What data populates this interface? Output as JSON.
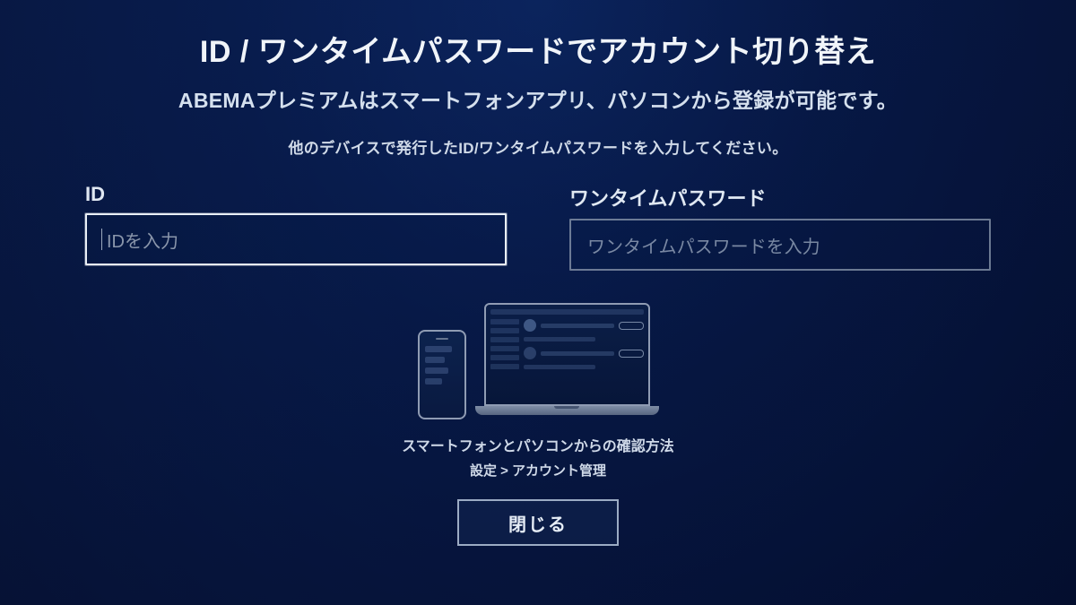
{
  "header": {
    "title": "ID / ワンタイムパスワードでアカウント切り替え",
    "subtitle": "ABEMAプレミアムはスマートフォンアプリ、パソコンから登録が可能です。",
    "instruction": "他のデバイスで発行したID/ワンタイムパスワードを入力してください。"
  },
  "form": {
    "id": {
      "label": "ID",
      "placeholder": "IDを入力"
    },
    "password": {
      "label": "ワンタイムパスワード",
      "placeholder": "ワンタイムパスワードを入力"
    }
  },
  "help": {
    "line1": "スマートフォンとパソコンからの確認方法",
    "line2": "設定 > アカウント管理"
  },
  "buttons": {
    "close": "閉じる"
  }
}
